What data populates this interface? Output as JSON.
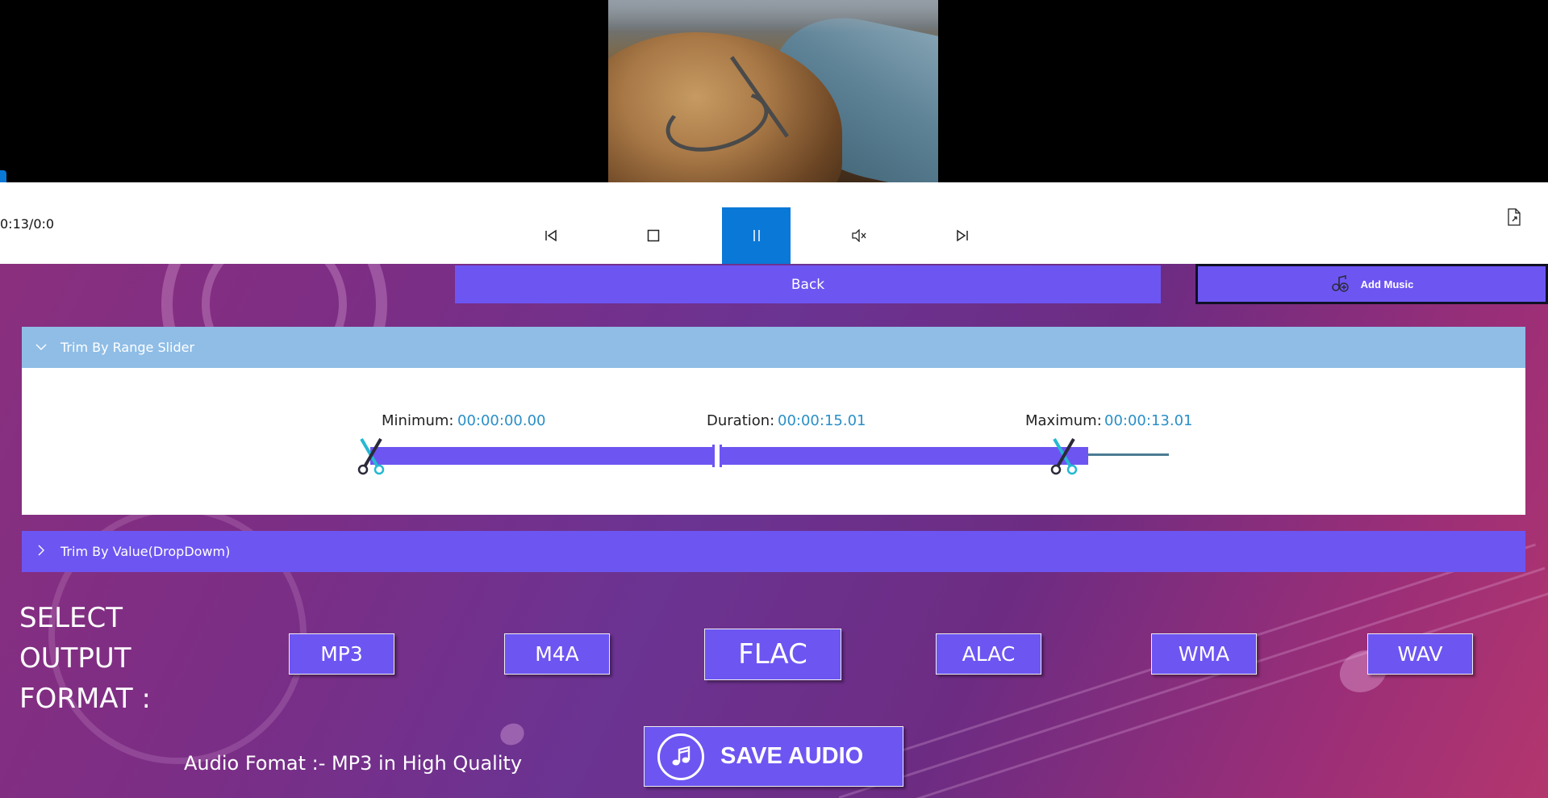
{
  "player": {
    "time_readout": "0:13/0:0",
    "position_fraction": 0.0
  },
  "controls": {
    "prev_icon": "skip-previous-icon",
    "stop_icon": "stop-icon",
    "pause_icon": "pause-icon",
    "mute_icon": "mute-icon",
    "next_icon": "skip-next-icon",
    "file_icon": "file-export-icon"
  },
  "toolbar": {
    "back_label": "Back",
    "add_music_label": "Add Music"
  },
  "trim_range": {
    "header": "Trim By Range Slider",
    "expanded": true,
    "minimum_label": "Minimum:",
    "minimum_value": "00:00:00.00",
    "duration_label": "Duration:",
    "duration_value": "00:00:15.01",
    "maximum_label": "Maximum:",
    "maximum_value": "00:00:13.01"
  },
  "trim_value": {
    "header": "Trim By Value(DropDowm)",
    "expanded": false
  },
  "output": {
    "select_label": "SELECT OUTPUT FORMAT :",
    "formats": [
      "MP3",
      "M4A",
      "FLAC",
      "ALAC",
      "WMA",
      "WAV"
    ],
    "selected": "FLAC",
    "audio_format_text": "Audio Fomat :- MP3 in High Quality",
    "save_label": "SAVE AUDIO"
  },
  "colors": {
    "accent": "#6d55f2",
    "player_accent": "#0a78d7",
    "expander_header": "#8fbde6",
    "value_text": "#2a8fc7"
  }
}
